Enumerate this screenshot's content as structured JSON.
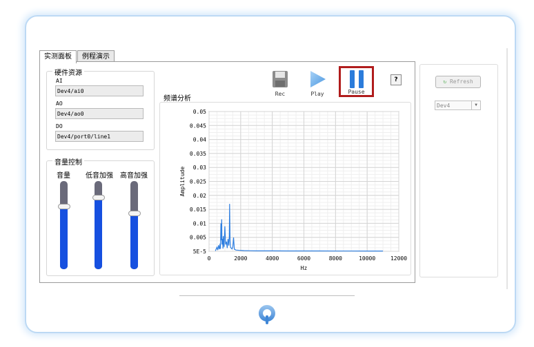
{
  "tabs": [
    {
      "label": "实测面板",
      "active": true
    },
    {
      "label": "例程演示",
      "active": false
    }
  ],
  "hardware": {
    "title": "硬件资源",
    "ai_label": "AI",
    "ai_value": "Dev4/ai0",
    "ao_label": "AO",
    "ao_value": "Dev4/ao0",
    "do_label": "DO",
    "do_value": "Dev4/port0/line1"
  },
  "audio": {
    "title": "音量控制",
    "sliders": [
      {
        "label": "音量",
        "level": 0.72
      },
      {
        "label": "低音加强",
        "level": 0.8
      },
      {
        "label": "高音加强",
        "level": 0.63
      }
    ]
  },
  "controls": {
    "rec_label": "Rec",
    "play_label": "Play",
    "pause_label": "Pause",
    "help_label": "?"
  },
  "spectrum": {
    "title": "频谱分析"
  },
  "chart_data": {
    "type": "line",
    "xlabel": "Hz",
    "ylabel": "Amplitude",
    "xlim": [
      0,
      12000
    ],
    "ylim": [
      5e-05,
      0.05
    ],
    "xticks": [
      "0",
      "2000",
      "4000",
      "6000",
      "8000",
      "10000",
      "12000"
    ],
    "yticks": [
      "5E-5",
      "0.005",
      "0.01",
      "0.015",
      "0.02",
      "0.025",
      "0.03",
      "0.035",
      "0.04",
      "0.045",
      "0.05"
    ],
    "grid": true,
    "series": [
      {
        "color": "#2f7fe0",
        "x": [
          400,
          500,
          550,
          600,
          650,
          700,
          720,
          750,
          780,
          800,
          820,
          850,
          880,
          900,
          950,
          1000,
          1050,
          1100,
          1150,
          1200,
          1250,
          1280,
          1300,
          1330,
          1360,
          1400,
          1450,
          1500,
          1550,
          1600,
          1700,
          1900,
          2200,
          2600,
          3000,
          4000,
          5000,
          6000,
          7000,
          8000,
          9000,
          10000,
          11000
        ],
        "y": [
          0.0002,
          0.0015,
          0.0005,
          0.0022,
          0.0008,
          0.0028,
          0.0009,
          0.01,
          0.004,
          0.0115,
          0.0025,
          0.0045,
          0.001,
          0.0055,
          0.0016,
          0.009,
          0.0025,
          0.0035,
          0.0012,
          0.0045,
          0.0021,
          0.0052,
          0.017,
          0.0038,
          0.0015,
          0.0012,
          0.0009,
          0.0015,
          0.005,
          0.0008,
          0.0005,
          0.0004,
          0.0003,
          0.00025,
          0.0002,
          0.0002,
          0.00018,
          0.00017,
          0.00017,
          0.00016,
          0.00016,
          0.00015,
          0.00015
        ]
      }
    ]
  },
  "right": {
    "refresh_label": "Refresh",
    "device_value": "Dev4"
  }
}
